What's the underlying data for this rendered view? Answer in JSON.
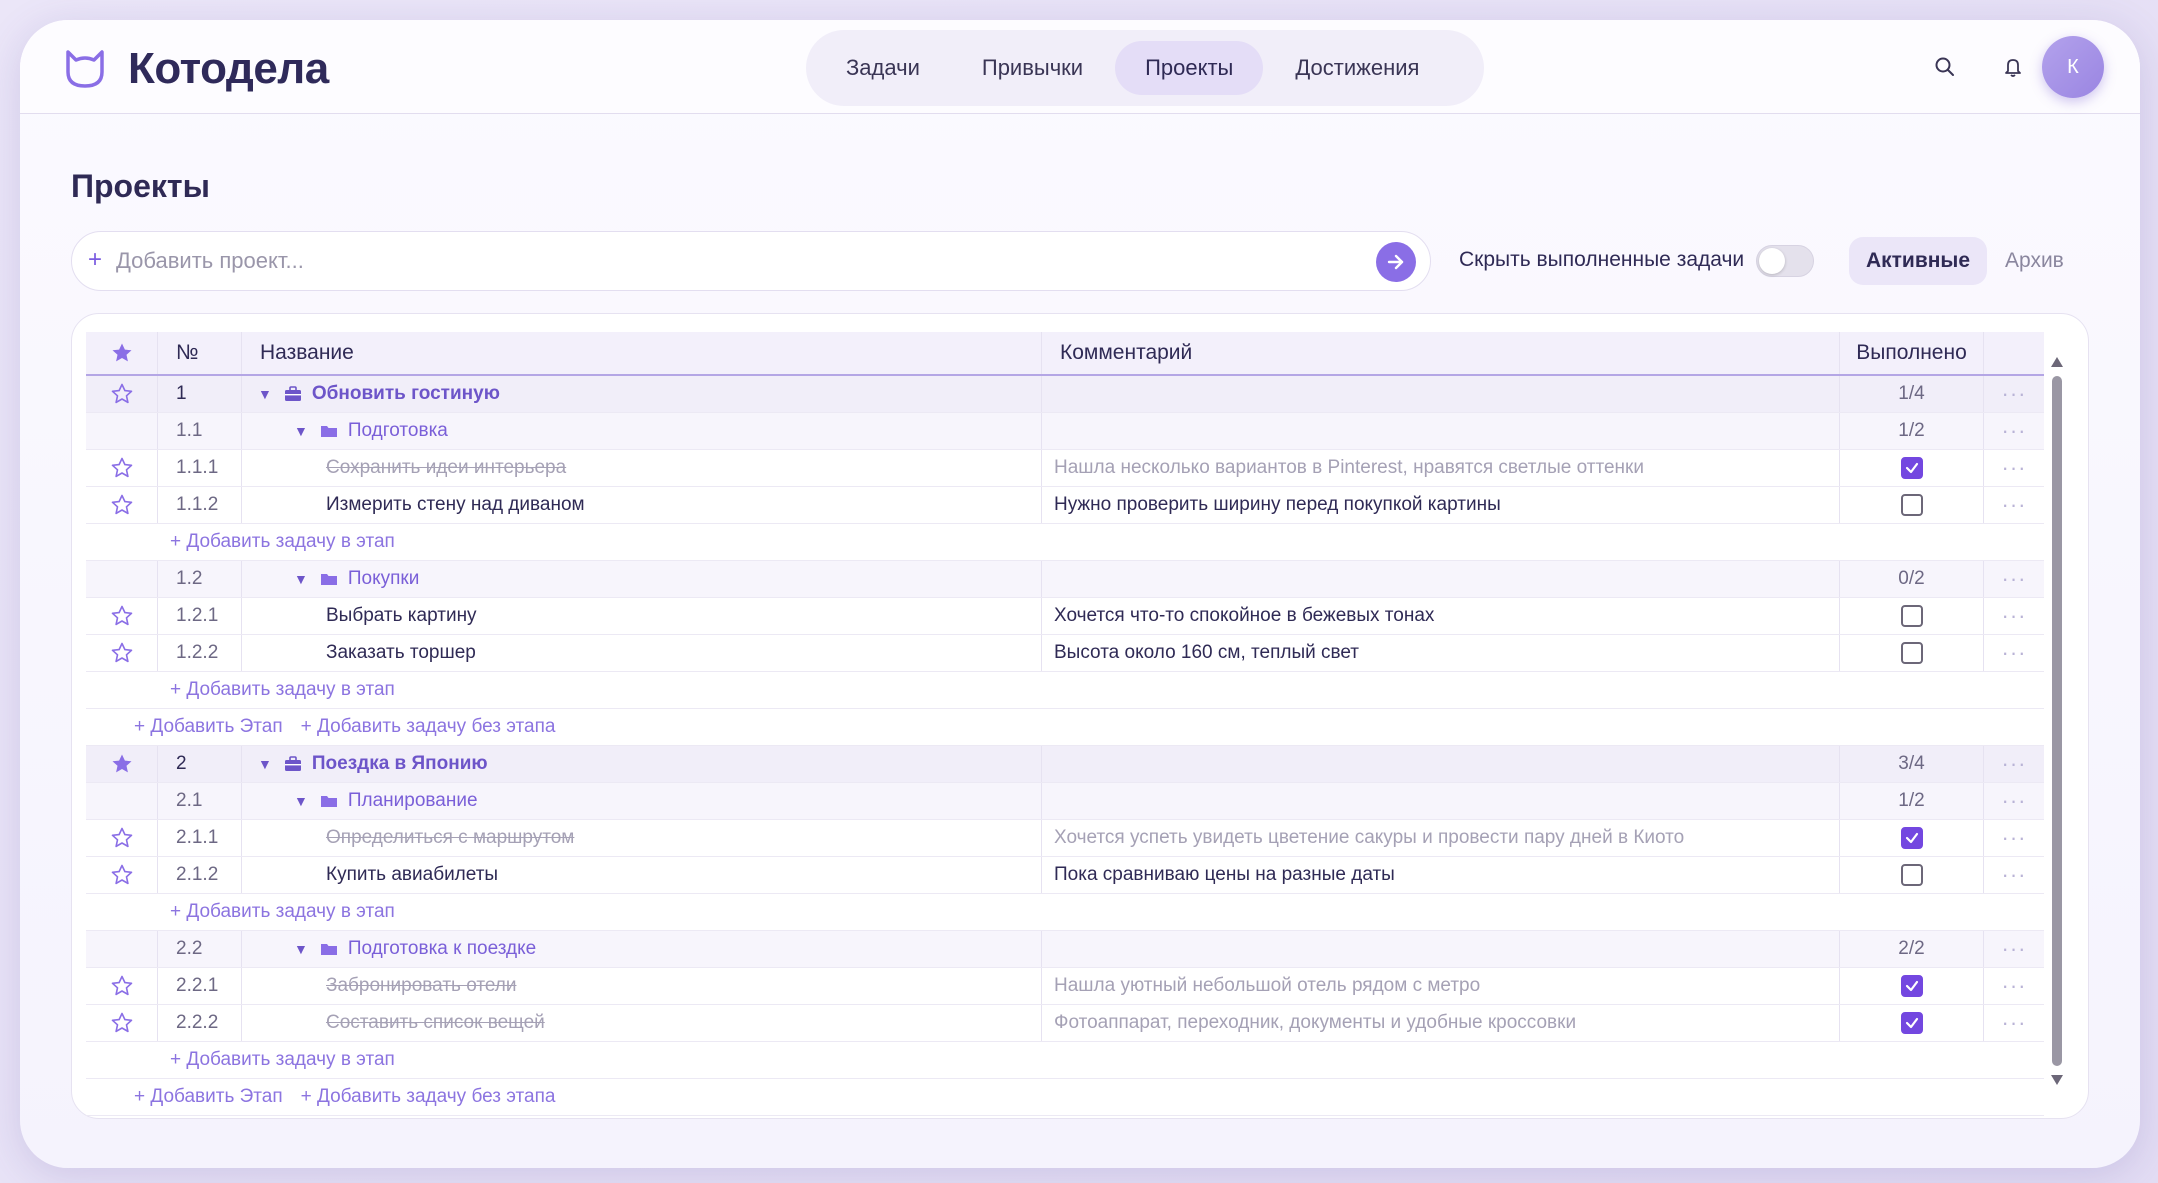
{
  "app": {
    "name": "Котодела"
  },
  "nav": {
    "items": [
      {
        "label": "Задачи",
        "active": false
      },
      {
        "label": "Привычки",
        "active": false
      },
      {
        "label": "Проекты",
        "active": true
      },
      {
        "label": "Достижения",
        "active": false
      }
    ]
  },
  "header": {
    "avatar_initial": "К",
    "icons": [
      "search-icon",
      "bell-icon"
    ]
  },
  "page": {
    "title": "Проекты"
  },
  "add_project": {
    "plus": "+",
    "placeholder": "Добавить проект..."
  },
  "filters": {
    "hide_done_label": "Скрыть выполненные задачи",
    "hide_done": false,
    "active_label": "Активные",
    "archive_label": "Архив"
  },
  "colors": {
    "accent": "#7347e0",
    "accent_soft": "#ebe6f8",
    "text": "#2f2a55"
  },
  "table": {
    "headers": {
      "num": "№",
      "name": "Название",
      "comment": "Комментарий",
      "done": "Выполнено"
    },
    "menu_glyph": "···",
    "add_task_to_stage": "+ Добавить задачу в этап",
    "add_stage": "+ Добавить Этап",
    "add_task_no_stage": "+ Добавить задачу без этапа",
    "projects": [
      {
        "num": "1",
        "name": "Обновить гостиную",
        "done": "1/4",
        "starred": false,
        "stages": [
          {
            "num": "1.1",
            "name": "Подготовка",
            "done": "1/2",
            "tasks": [
              {
                "num": "1.1.1",
                "name": "Сохранить идеи интерьера",
                "comment": "Нашла несколько вариантов в Pinterest, нравятся светлые оттенки",
                "completed": true,
                "starred": false
              },
              {
                "num": "1.1.2",
                "name": "Измерить стену над диваном",
                "comment": "Нужно проверить ширину перед покупкой картины",
                "completed": false,
                "starred": false
              }
            ]
          },
          {
            "num": "1.2",
            "name": "Покупки",
            "done": "0/2",
            "tasks": [
              {
                "num": "1.2.1",
                "name": "Выбрать картину",
                "comment": "Хочется что-то спокойное в бежевых тонах",
                "completed": false,
                "starred": false
              },
              {
                "num": "1.2.2",
                "name": "Заказать торшер",
                "comment": "Высота около 160 см, теплый свет",
                "completed": false,
                "starred": false
              }
            ]
          }
        ]
      },
      {
        "num": "2",
        "name": "Поездка в Японию",
        "done": "3/4",
        "starred": true,
        "stages": [
          {
            "num": "2.1",
            "name": "Планирование",
            "done": "1/2",
            "tasks": [
              {
                "num": "2.1.1",
                "name": "Определиться с маршрутом",
                "comment": "Хочется успеть увидеть цветение сакуры и провести пару дней в Киото",
                "completed": true,
                "starred": false
              },
              {
                "num": "2.1.2",
                "name": "Купить авиабилеты",
                "comment": "Пока сравниваю цены на разные даты",
                "completed": false,
                "starred": false
              }
            ]
          },
          {
            "num": "2.2",
            "name": "Подготовка к поездке",
            "done": "2/2",
            "tasks": [
              {
                "num": "2.2.1",
                "name": "Забронировать отели",
                "comment": "Нашла уютный небольшой отель рядом с метро",
                "completed": true,
                "starred": false
              },
              {
                "num": "2.2.2",
                "name": "Составить список вещей",
                "comment": "Фотоаппарат, переходник, документы и удобные кроссовки",
                "completed": true,
                "starred": false
              }
            ]
          }
        ]
      }
    ]
  }
}
